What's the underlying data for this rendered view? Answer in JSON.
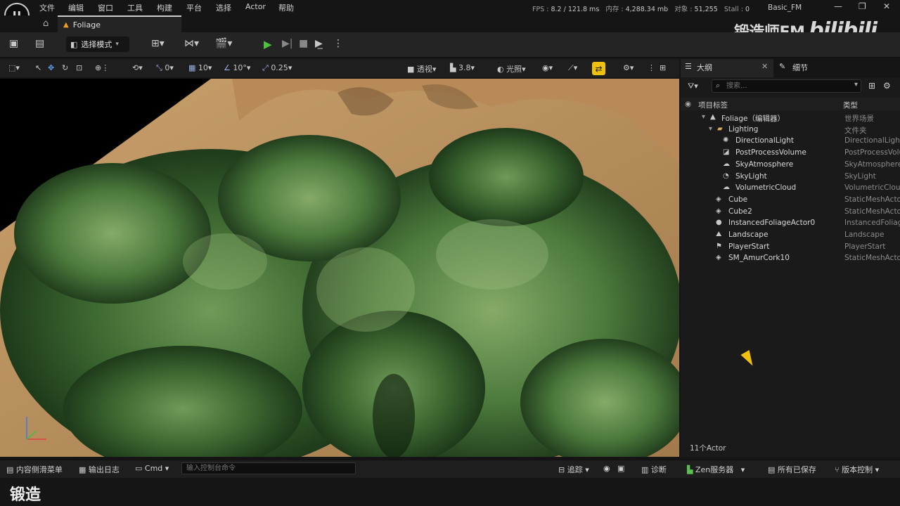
{
  "menu": {
    "items": [
      "文件",
      "编辑",
      "窗口",
      "工具",
      "构建",
      "平台",
      "选择",
      "Actor",
      "帮助"
    ]
  },
  "stats": {
    "fps_label": "FPS :",
    "fps_value": "8.2",
    "ms_value": "/ 121.8 ms",
    "mem_label": "内存 :",
    "mem_value": "4,288.34 mb",
    "obj_label": "对象 :",
    "obj_value": "51,255",
    "stall_label": "Stall :",
    "stall_value": "0"
  },
  "project_name": "Basic_FM",
  "tab": {
    "label": "Foliage"
  },
  "watermark": {
    "text": "锻造师FM",
    "brand": "bilibili"
  },
  "toolbar": {
    "select_mode": "选择模式"
  },
  "viewport_toolbar": {
    "rotate_value": "0",
    "grid_value": "10",
    "angle_value": "10°",
    "scale_value": "0.25",
    "perspective": "透视",
    "camera_speed": "3.8",
    "lighting": "光照"
  },
  "right_panel": {
    "outliner_tab": "大纲",
    "details_tab": "细节",
    "search_placeholder": "搜索...",
    "col_label": "项目标签",
    "col_type": "类型",
    "rows": [
      {
        "name": "Foliage（编辑器）",
        "type": "世界场景",
        "icon": "world-icon"
      },
      {
        "name": "Lighting",
        "type": "文件夹",
        "icon": "folder-icon"
      },
      {
        "name": "DirectionalLight",
        "type": "DirectionalLight",
        "icon": "directional-light-icon"
      },
      {
        "name": "PostProcessVolume",
        "type": "PostProcessVolume",
        "icon": "postprocess-icon"
      },
      {
        "name": "SkyAtmosphere",
        "type": "SkyAtmosphere",
        "icon": "sky-atmosphere-icon"
      },
      {
        "name": "SkyLight",
        "type": "SkyLight",
        "icon": "skylight-icon"
      },
      {
        "name": "VolumetricCloud",
        "type": "VolumetricCloud",
        "icon": "cloud-icon"
      },
      {
        "name": "Cube",
        "type": "StaticMeshActor",
        "icon": "static-mesh-icon"
      },
      {
        "name": "Cube2",
        "type": "StaticMeshActor",
        "icon": "static-mesh-icon"
      },
      {
        "name": "InstancedFoliageActor0",
        "type": "InstancedFoliageActor",
        "icon": "foliage-actor-icon"
      },
      {
        "name": "Landscape",
        "type": "Landscape",
        "icon": "landscape-icon"
      },
      {
        "name": "PlayerStart",
        "type": "PlayerStart",
        "icon": "player-start-icon"
      },
      {
        "name": "SM_AmurCork10",
        "type": "StaticMeshActor",
        "icon": "static-mesh-icon"
      }
    ],
    "actor_count": "11个Actor"
  },
  "statusbar": {
    "content_drawer": "内容侧滑菜单",
    "output_log": "输出日志",
    "cmd": "Cmd",
    "cmd_placeholder": "输入控制台命令",
    "trace": "追踪",
    "diagnostics": "诊断",
    "zen": "Zen服务器",
    "all_saved": "所有已保存",
    "source_control": "版本控制"
  },
  "subtitle": "锻造",
  "colors": {
    "accent_yellow": "#f0c010",
    "play_green": "#4fc040",
    "panel_bg": "#1a1a1a"
  }
}
